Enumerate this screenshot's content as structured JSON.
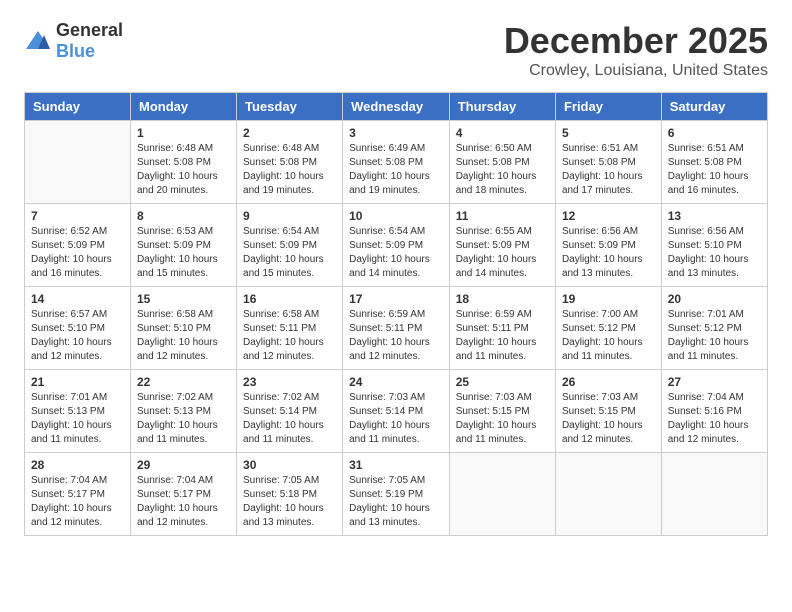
{
  "logo": {
    "general": "General",
    "blue": "Blue"
  },
  "title": "December 2025",
  "location": "Crowley, Louisiana, United States",
  "headers": [
    "Sunday",
    "Monday",
    "Tuesday",
    "Wednesday",
    "Thursday",
    "Friday",
    "Saturday"
  ],
  "weeks": [
    [
      {
        "day": "",
        "info": ""
      },
      {
        "day": "1",
        "info": "Sunrise: 6:48 AM\nSunset: 5:08 PM\nDaylight: 10 hours\nand 20 minutes."
      },
      {
        "day": "2",
        "info": "Sunrise: 6:48 AM\nSunset: 5:08 PM\nDaylight: 10 hours\nand 19 minutes."
      },
      {
        "day": "3",
        "info": "Sunrise: 6:49 AM\nSunset: 5:08 PM\nDaylight: 10 hours\nand 19 minutes."
      },
      {
        "day": "4",
        "info": "Sunrise: 6:50 AM\nSunset: 5:08 PM\nDaylight: 10 hours\nand 18 minutes."
      },
      {
        "day": "5",
        "info": "Sunrise: 6:51 AM\nSunset: 5:08 PM\nDaylight: 10 hours\nand 17 minutes."
      },
      {
        "day": "6",
        "info": "Sunrise: 6:51 AM\nSunset: 5:08 PM\nDaylight: 10 hours\nand 16 minutes."
      }
    ],
    [
      {
        "day": "7",
        "info": "Sunrise: 6:52 AM\nSunset: 5:09 PM\nDaylight: 10 hours\nand 16 minutes."
      },
      {
        "day": "8",
        "info": "Sunrise: 6:53 AM\nSunset: 5:09 PM\nDaylight: 10 hours\nand 15 minutes."
      },
      {
        "day": "9",
        "info": "Sunrise: 6:54 AM\nSunset: 5:09 PM\nDaylight: 10 hours\nand 15 minutes."
      },
      {
        "day": "10",
        "info": "Sunrise: 6:54 AM\nSunset: 5:09 PM\nDaylight: 10 hours\nand 14 minutes."
      },
      {
        "day": "11",
        "info": "Sunrise: 6:55 AM\nSunset: 5:09 PM\nDaylight: 10 hours\nand 14 minutes."
      },
      {
        "day": "12",
        "info": "Sunrise: 6:56 AM\nSunset: 5:09 PM\nDaylight: 10 hours\nand 13 minutes."
      },
      {
        "day": "13",
        "info": "Sunrise: 6:56 AM\nSunset: 5:10 PM\nDaylight: 10 hours\nand 13 minutes."
      }
    ],
    [
      {
        "day": "14",
        "info": "Sunrise: 6:57 AM\nSunset: 5:10 PM\nDaylight: 10 hours\nand 12 minutes."
      },
      {
        "day": "15",
        "info": "Sunrise: 6:58 AM\nSunset: 5:10 PM\nDaylight: 10 hours\nand 12 minutes."
      },
      {
        "day": "16",
        "info": "Sunrise: 6:58 AM\nSunset: 5:11 PM\nDaylight: 10 hours\nand 12 minutes."
      },
      {
        "day": "17",
        "info": "Sunrise: 6:59 AM\nSunset: 5:11 PM\nDaylight: 10 hours\nand 12 minutes."
      },
      {
        "day": "18",
        "info": "Sunrise: 6:59 AM\nSunset: 5:11 PM\nDaylight: 10 hours\nand 11 minutes."
      },
      {
        "day": "19",
        "info": "Sunrise: 7:00 AM\nSunset: 5:12 PM\nDaylight: 10 hours\nand 11 minutes."
      },
      {
        "day": "20",
        "info": "Sunrise: 7:01 AM\nSunset: 5:12 PM\nDaylight: 10 hours\nand 11 minutes."
      }
    ],
    [
      {
        "day": "21",
        "info": "Sunrise: 7:01 AM\nSunset: 5:13 PM\nDaylight: 10 hours\nand 11 minutes."
      },
      {
        "day": "22",
        "info": "Sunrise: 7:02 AM\nSunset: 5:13 PM\nDaylight: 10 hours\nand 11 minutes."
      },
      {
        "day": "23",
        "info": "Sunrise: 7:02 AM\nSunset: 5:14 PM\nDaylight: 10 hours\nand 11 minutes."
      },
      {
        "day": "24",
        "info": "Sunrise: 7:03 AM\nSunset: 5:14 PM\nDaylight: 10 hours\nand 11 minutes."
      },
      {
        "day": "25",
        "info": "Sunrise: 7:03 AM\nSunset: 5:15 PM\nDaylight: 10 hours\nand 11 minutes."
      },
      {
        "day": "26",
        "info": "Sunrise: 7:03 AM\nSunset: 5:15 PM\nDaylight: 10 hours\nand 12 minutes."
      },
      {
        "day": "27",
        "info": "Sunrise: 7:04 AM\nSunset: 5:16 PM\nDaylight: 10 hours\nand 12 minutes."
      }
    ],
    [
      {
        "day": "28",
        "info": "Sunrise: 7:04 AM\nSunset: 5:17 PM\nDaylight: 10 hours\nand 12 minutes."
      },
      {
        "day": "29",
        "info": "Sunrise: 7:04 AM\nSunset: 5:17 PM\nDaylight: 10 hours\nand 12 minutes."
      },
      {
        "day": "30",
        "info": "Sunrise: 7:05 AM\nSunset: 5:18 PM\nDaylight: 10 hours\nand 13 minutes."
      },
      {
        "day": "31",
        "info": "Sunrise: 7:05 AM\nSunset: 5:19 PM\nDaylight: 10 hours\nand 13 minutes."
      },
      {
        "day": "",
        "info": ""
      },
      {
        "day": "",
        "info": ""
      },
      {
        "day": "",
        "info": ""
      }
    ]
  ]
}
